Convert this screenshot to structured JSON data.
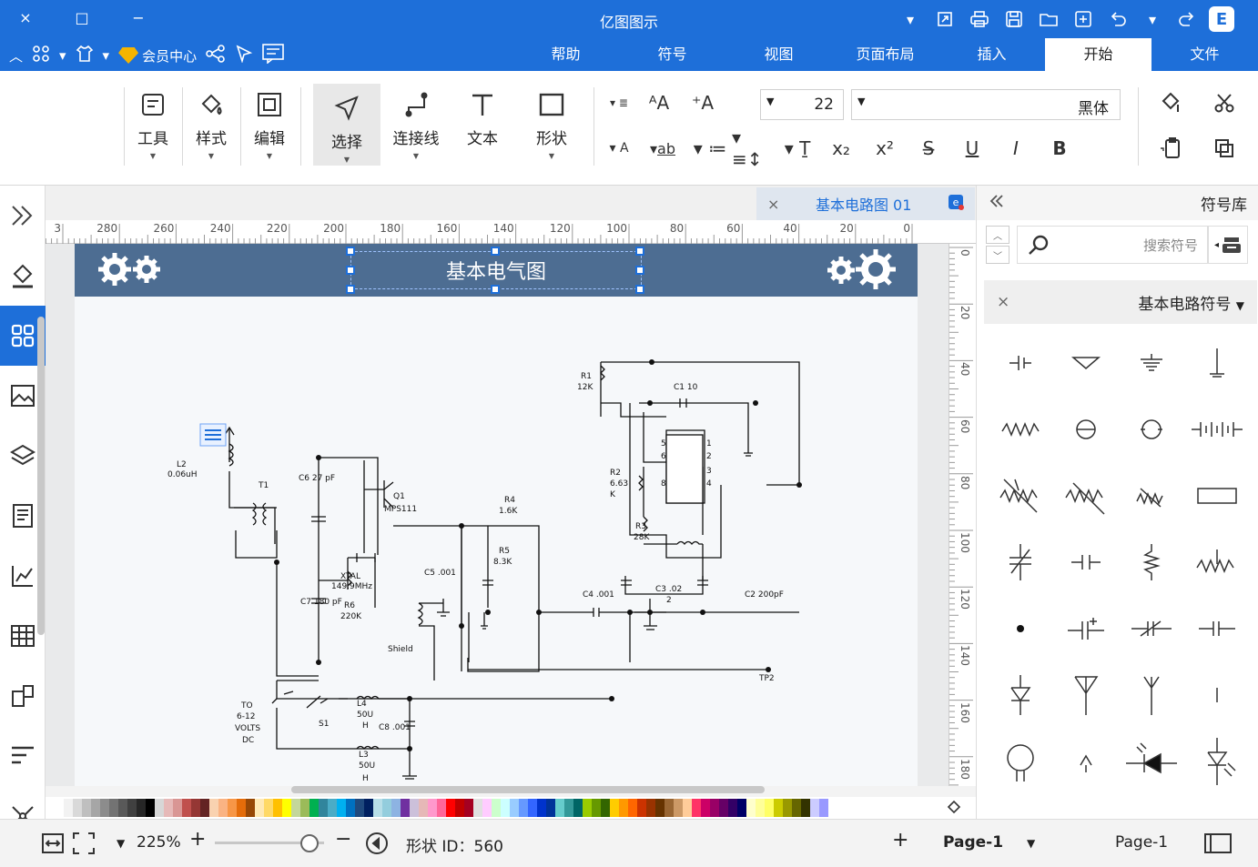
{
  "app": {
    "title": "亿图图示",
    "brand_letter": "E"
  },
  "titlebar": {
    "window_buttons": [
      "×",
      "□",
      "−"
    ],
    "quick_tools": [
      "expand-icon",
      "open-icon",
      "print-icon",
      "save-icon",
      "folder-icon",
      "new-icon",
      "undo-icon",
      "redo-icon"
    ]
  },
  "menubar": {
    "member_label": "会员中心",
    "tabs": [
      "文件",
      "开始",
      "插入",
      "页面布局",
      "视图",
      "符号",
      "帮助"
    ],
    "active_tab": "开始"
  },
  "ribbon": {
    "tools": [
      "工具",
      "样式",
      "编辑",
      "选择",
      "连接线",
      "文本",
      "形状"
    ],
    "font_name": "黑体",
    "font_size": "22"
  },
  "document": {
    "tab_label": "基本电路图 01",
    "banner_title": "基本电气图"
  },
  "ruler": {
    "h_ticks": [
      "0",
      "20",
      "40",
      "60",
      "80",
      "100",
      "120",
      "140",
      "160",
      "180",
      "200",
      "220",
      "240",
      "260",
      "280",
      "3"
    ],
    "v_ticks": [
      "0",
      "20",
      "40",
      "60",
      "80",
      "100",
      "120",
      "140",
      "160",
      "180"
    ]
  },
  "circuit": {
    "labels": [
      "L2",
      "0.06uH",
      "T1",
      "C6 27 pF",
      "Q1",
      "MPS111",
      "R4",
      "1.6K",
      "R5",
      "8.3K",
      "C5 .001",
      "XTAL",
      "149.9MHz",
      "R6",
      "220K",
      "C7 180 pF",
      "Shield",
      "TP2",
      "L4",
      "50U",
      "H",
      "S1",
      "C8 .001",
      "L3",
      "50U",
      "H",
      "TO",
      "6-12",
      "VOLTS",
      "DC",
      "R1",
      "12K",
      "C1 10",
      "R2",
      "6.63",
      "K",
      "R3",
      "28K",
      "C4 .001",
      "C3 .02",
      "2",
      "C2 200pF",
      "5",
      "6",
      "8",
      "1",
      "2",
      "3",
      "4"
    ]
  },
  "library": {
    "title": "符号库",
    "search_placeholder": "搜索符号",
    "category": "基本电路符号"
  },
  "statusbar": {
    "left_page": "Page-1",
    "active_page": "Page-1",
    "shape_id": "形状 ID：560",
    "zoom": "225%"
  },
  "colors": {
    "accent": "#1e6fd9",
    "banner": "#4d6d92",
    "palette": [
      "#ffffff",
      "#f2f2f2",
      "#d9d9d9",
      "#bfbfbf",
      "#a6a6a6",
      "#8c8c8c",
      "#737373",
      "#595959",
      "#404040",
      "#262626",
      "#000000",
      "#d7d7d7",
      "#e6b9b8",
      "#d99694",
      "#c0504d",
      "#953734",
      "#632423",
      "#f9d2b0",
      "#fab383",
      "#f79646",
      "#e46c0a",
      "#974806",
      "#ffe9b5",
      "#ffd966",
      "#ffc000",
      "#ffff00",
      "#c4d79b",
      "#9bbb59",
      "#00b050",
      "#31859c",
      "#4bacc6",
      "#00b0f0",
      "#0070c0",
      "#1f497d",
      "#002060",
      "#b7dee8",
      "#93cddd",
      "#8db3e2",
      "#7030a0",
      "#ccc0da",
      "#e6b8b7",
      "#ff99cc",
      "#ff6699",
      "#ff0000",
      "#c00000",
      "#a50021",
      "#e0e0e0",
      "#ffccff",
      "#ccffcc",
      "#ccffff",
      "#99ccff",
      "#6699ff",
      "#3366ff",
      "#0033cc",
      "#003399",
      "#66cccc",
      "#339999",
      "#006666",
      "#99cc00",
      "#669900",
      "#336600",
      "#ffcc00",
      "#ff9900",
      "#ff6600",
      "#cc3300",
      "#993300",
      "#663300",
      "#996633",
      "#cc9966",
      "#ffcc99",
      "#ff3366",
      "#cc0066",
      "#990066",
      "#660066",
      "#330066",
      "#000066",
      "#ffffcc",
      "#ffff99",
      "#ffff66",
      "#cccc00",
      "#999900",
      "#666600",
      "#333300",
      "#ccccff",
      "#9999ff"
    ]
  }
}
